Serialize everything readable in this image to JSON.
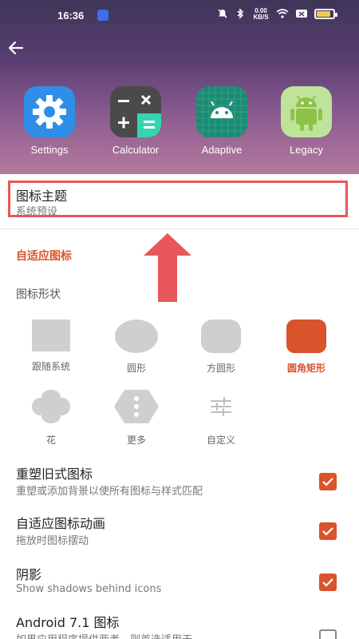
{
  "status_bar": {
    "time": "16:36",
    "net_speed": "0.00\nKB/S",
    "battery_level": 0.75
  },
  "preview_icons": [
    {
      "label": "Settings",
      "icon": "gear-icon"
    },
    {
      "label": "Calculator",
      "icon": "calculator-icon"
    },
    {
      "label": "Adaptive",
      "icon": "android-icon"
    },
    {
      "label": "Legacy",
      "icon": "android-icon"
    }
  ],
  "icon_theme": {
    "title": "图标主题",
    "value": "系统预设"
  },
  "adaptive_section": {
    "title": "自适应图标",
    "shape_heading": "图标形状"
  },
  "shapes": [
    {
      "label": "跟随系统",
      "selected": false
    },
    {
      "label": "圆形",
      "selected": false
    },
    {
      "label": "方圆形",
      "selected": false
    },
    {
      "label": "圆角矩形",
      "selected": true
    },
    {
      "label": "花",
      "selected": false
    },
    {
      "label": "更多",
      "selected": false
    },
    {
      "label": "自定义",
      "selected": false
    }
  ],
  "settings": [
    {
      "title": "重塑旧式图标",
      "subtitle": "重塑或添加背景以使所有图标与样式匹配",
      "checked": true
    },
    {
      "title": "自适应图标动画",
      "subtitle": "拖放时图标摆动",
      "checked": true
    },
    {
      "title": "阴影",
      "subtitle": "Show shadows behind icons",
      "checked": true
    },
    {
      "title": "Android 7.1 图标",
      "subtitle": "如果应用程序提供两者，则首选适用于",
      "checked": false
    }
  ],
  "colors": {
    "accent": "#d9532b",
    "highlight": "#e8585a"
  }
}
